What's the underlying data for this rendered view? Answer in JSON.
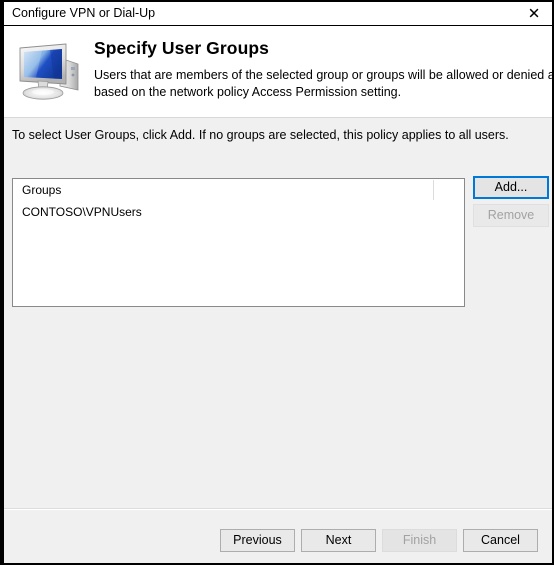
{
  "window": {
    "title": "Configure VPN or Dial-Up",
    "close_icon": "close-icon"
  },
  "header": {
    "icon": "computer-monitor-icon",
    "title": "Specify User Groups",
    "description_line1": "Users that are members of the selected group or groups will be allowed or denied access",
    "description_line2": "based on the network policy Access Permission setting."
  },
  "body": {
    "instruction": "To select User Groups, click Add. If no groups are selected, this policy applies to all users."
  },
  "groups_list": {
    "column_header": "Groups",
    "rows": [
      "CONTOSO\\VPNUsers"
    ]
  },
  "side_buttons": {
    "add_label": "Add...",
    "remove_label": "Remove"
  },
  "footer": {
    "previous_label": "Previous",
    "next_label": "Next",
    "finish_label": "Finish",
    "cancel_label": "Cancel"
  },
  "colors": {
    "focus_blue": "#0078d7",
    "body_background": "#f0f0f0",
    "disabled_text": "#a2a2a2",
    "listbox_border": "#898989"
  }
}
